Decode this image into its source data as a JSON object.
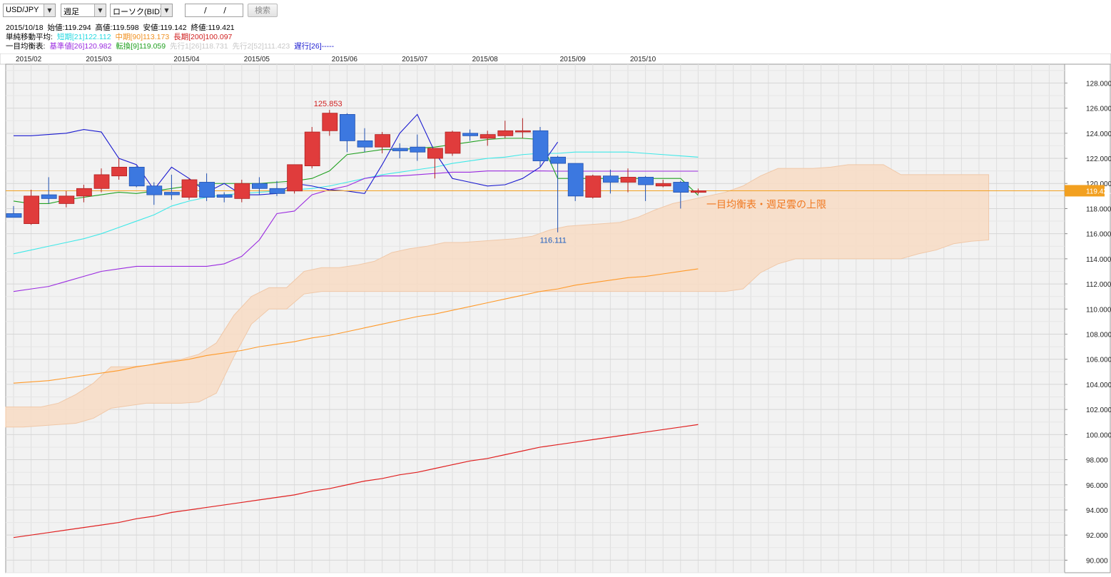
{
  "toolbar": {
    "symbol": "USD/JPY",
    "period": "週足",
    "chart_type": "ローソク(BID)",
    "date_value": "/ /",
    "search_label": "検索"
  },
  "ohlc_line": {
    "date": "2015/10/18",
    "open_label": "始値:119.294",
    "high_label": "高値:119.598",
    "low_label": "安値:119.142",
    "close_label": "終値:119.421"
  },
  "sma_line": {
    "label": "単純移動平均:",
    "short": "短期[21]122.112",
    "mid": "中期[90]113.173",
    "long": "長期[200]100.097"
  },
  "ichimoku_line": {
    "label": "一目均衡表:",
    "kijun": "基準値[26]120.982",
    "tenkan": "転換[9]119.059",
    "senko1": "先行1[26]118.731",
    "senko2": "先行2[52]111.423",
    "chikou": "遅行[26]-----"
  },
  "colors": {
    "up": "#e03c3c",
    "down": "#3c78e0",
    "sma_short": "#3ee8e8",
    "sma_mid": "#ff9a2a",
    "sma_long": "#e02020",
    "kijun": "#9a2ae0",
    "tenkan": "#20a020",
    "chikou": "#1a1ad0",
    "cloud": "#f8dcc4",
    "current": "#f2a020"
  },
  "chart_data": {
    "type": "candlestick",
    "x_labels": [
      "2015/02",
      "2015/03",
      "2015/04",
      "2015/05",
      "2015/06",
      "2015/07",
      "2015/08",
      "2015/09",
      "2015/10"
    ],
    "y_ticks": [
      "90.000",
      "92.000",
      "94.000",
      "96.000",
      "98.000",
      "100.000",
      "102.000",
      "104.000",
      "106.000",
      "108.000",
      "110.000",
      "112.000",
      "114.000",
      "116.000",
      "118.000",
      "120.000",
      "122.000",
      "124.000",
      "126.000",
      "128.000"
    ],
    "ylim": [
      89,
      129.5
    ],
    "current_price": "119.421",
    "high_annotation": "125.853",
    "low_annotation": "116.111",
    "cloud_annotation": "一目均衡表・週足雲の上限",
    "candles": [
      {
        "o": 117.6,
        "h": 118.2,
        "l": 117.3,
        "c": 117.3
      },
      {
        "o": 116.8,
        "h": 119.5,
        "l": 116.7,
        "c": 119.0
      },
      {
        "o": 119.1,
        "h": 120.5,
        "l": 118.4,
        "c": 118.8
      },
      {
        "o": 118.4,
        "h": 119.4,
        "l": 118.1,
        "c": 119.0
      },
      {
        "o": 119.0,
        "h": 119.9,
        "l": 118.5,
        "c": 119.6
      },
      {
        "o": 119.6,
        "h": 121.2,
        "l": 119.3,
        "c": 120.7
      },
      {
        "o": 120.6,
        "h": 122.0,
        "l": 120.3,
        "c": 121.3
      },
      {
        "o": 121.3,
        "h": 121.4,
        "l": 119.7,
        "c": 119.8
      },
      {
        "o": 119.8,
        "h": 120.1,
        "l": 118.3,
        "c": 119.1
      },
      {
        "o": 119.3,
        "h": 120.7,
        "l": 118.7,
        "c": 119.1
      },
      {
        "o": 118.9,
        "h": 120.4,
        "l": 118.7,
        "c": 120.3
      },
      {
        "o": 120.1,
        "h": 120.8,
        "l": 118.6,
        "c": 118.9
      },
      {
        "o": 119.1,
        "h": 119.3,
        "l": 118.5,
        "c": 118.9
      },
      {
        "o": 118.8,
        "h": 120.3,
        "l": 118.5,
        "c": 120.0
      },
      {
        "o": 120.0,
        "h": 120.5,
        "l": 119.1,
        "c": 119.6
      },
      {
        "o": 119.6,
        "h": 120.2,
        "l": 119.0,
        "c": 119.2
      },
      {
        "o": 119.4,
        "h": 121.5,
        "l": 119.2,
        "c": 121.5
      },
      {
        "o": 121.4,
        "h": 124.5,
        "l": 121.2,
        "c": 124.1
      },
      {
        "o": 124.2,
        "h": 125.853,
        "l": 123.8,
        "c": 125.6
      },
      {
        "o": 125.5,
        "h": 125.6,
        "l": 122.5,
        "c": 123.4
      },
      {
        "o": 123.4,
        "h": 124.4,
        "l": 122.5,
        "c": 122.9
      },
      {
        "o": 122.9,
        "h": 124.1,
        "l": 122.4,
        "c": 123.9
      },
      {
        "o": 122.8,
        "h": 123.2,
        "l": 122.0,
        "c": 122.6
      },
      {
        "o": 122.9,
        "h": 123.9,
        "l": 121.8,
        "c": 122.5
      },
      {
        "o": 122.0,
        "h": 122.8,
        "l": 120.4,
        "c": 122.8
      },
      {
        "o": 122.4,
        "h": 124.2,
        "l": 122.2,
        "c": 124.1
      },
      {
        "o": 124.0,
        "h": 124.3,
        "l": 123.4,
        "c": 123.8
      },
      {
        "o": 123.6,
        "h": 124.2,
        "l": 123.0,
        "c": 123.9
      },
      {
        "o": 123.8,
        "h": 125.0,
        "l": 123.6,
        "c": 124.2
      },
      {
        "o": 124.1,
        "h": 125.2,
        "l": 123.6,
        "c": 124.2
      },
      {
        "o": 124.2,
        "h": 124.5,
        "l": 121.3,
        "c": 121.8
      },
      {
        "o": 122.1,
        "h": 122.2,
        "l": 116.111,
        "c": 121.6
      },
      {
        "o": 121.6,
        "h": 121.6,
        "l": 118.6,
        "c": 119.0
      },
      {
        "o": 118.9,
        "h": 120.7,
        "l": 118.8,
        "c": 120.6
      },
      {
        "o": 120.6,
        "h": 121.1,
        "l": 119.2,
        "c": 120.1
      },
      {
        "o": 120.1,
        "h": 121.2,
        "l": 119.3,
        "c": 120.5
      },
      {
        "o": 120.5,
        "h": 120.6,
        "l": 118.6,
        "c": 119.9
      },
      {
        "o": 119.8,
        "h": 120.3,
        "l": 119.7,
        "c": 120.0
      },
      {
        "o": 120.1,
        "h": 120.2,
        "l": 118.0,
        "c": 119.3
      },
      {
        "o": 119.294,
        "h": 119.598,
        "l": 119.142,
        "c": 119.421
      }
    ],
    "sma_short": [
      114.4,
      114.7,
      115.0,
      115.3,
      115.6,
      116.0,
      116.5,
      117.0,
      117.5,
      118.2,
      118.6,
      118.9,
      119.1,
      119.2,
      119.3,
      119.4,
      119.5,
      119.6,
      119.8,
      120.1,
      120.4,
      120.7,
      120.9,
      121.1,
      121.3,
      121.6,
      121.8,
      122.0,
      122.1,
      122.3,
      122.4,
      122.4,
      122.5,
      122.5,
      122.5,
      122.5,
      122.4,
      122.3,
      122.2,
      122.1
    ],
    "sma_mid": [
      104.1,
      104.2,
      104.3,
      104.5,
      104.7,
      104.9,
      105.1,
      105.4,
      105.6,
      105.8,
      106.0,
      106.3,
      106.5,
      106.7,
      107.0,
      107.2,
      107.4,
      107.7,
      107.9,
      108.2,
      108.5,
      108.8,
      109.1,
      109.4,
      109.6,
      109.9,
      110.2,
      110.5,
      110.8,
      111.1,
      111.4,
      111.6,
      111.9,
      112.1,
      112.3,
      112.5,
      112.6,
      112.8,
      113.0,
      113.2
    ],
    "sma_long": [
      91.8,
      92.0,
      92.2,
      92.4,
      92.6,
      92.8,
      93.0,
      93.3,
      93.5,
      93.8,
      94.0,
      94.2,
      94.4,
      94.6,
      94.8,
      95.0,
      95.2,
      95.5,
      95.7,
      96.0,
      96.3,
      96.5,
      96.8,
      97.0,
      97.3,
      97.6,
      97.9,
      98.1,
      98.4,
      98.7,
      99.0,
      99.2,
      99.4,
      99.6,
      99.8,
      100.0,
      100.2,
      100.4,
      100.6,
      100.8
    ],
    "kijun": [
      111.4,
      111.6,
      111.8,
      112.2,
      112.6,
      113.0,
      113.2,
      113.4,
      113.4,
      113.4,
      113.4,
      113.4,
      113.6,
      114.2,
      115.5,
      117.6,
      117.8,
      119.1,
      119.5,
      119.8,
      120.4,
      120.6,
      120.6,
      120.7,
      120.8,
      120.9,
      120.9,
      121.0,
      121.0,
      121.0,
      121.0,
      120.98,
      120.98,
      120.98,
      120.98,
      120.98,
      120.98,
      120.98,
      120.98,
      120.98
    ],
    "tenkan": [
      118.6,
      118.4,
      118.4,
      118.7,
      118.9,
      119.1,
      119.3,
      119.2,
      119.4,
      119.6,
      119.8,
      120.0,
      120.0,
      120.0,
      120.0,
      120.1,
      120.2,
      120.4,
      121.0,
      122.3,
      122.5,
      122.7,
      122.7,
      122.8,
      122.9,
      123.1,
      123.3,
      123.5,
      123.6,
      123.6,
      123.5,
      120.4,
      120.4,
      120.4,
      120.4,
      120.4,
      120.4,
      120.4,
      120.4,
      119.06
    ],
    "chikou": [
      123.8,
      123.8,
      123.9,
      124.0,
      124.3,
      124.1,
      122.0,
      121.5,
      119.5,
      121.3,
      120.4,
      119.3,
      120.0,
      119.1,
      119.1,
      119.2,
      120.0,
      119.8,
      119.5,
      119.4,
      119.2,
      121.5,
      124.0,
      125.5,
      122.5,
      120.4,
      120.1,
      119.8,
      119.9,
      120.4,
      121.3,
      123.3
    ],
    "cloud_top": [
      102.2,
      102.2,
      102.2,
      102.5,
      103.2,
      104.1,
      105.4,
      105.4,
      105.5,
      105.8,
      106.0,
      106.4,
      107.3,
      109.5,
      111.0,
      111.7,
      111.7,
      113.0,
      113.3,
      113.3,
      113.5,
      113.8,
      114.5,
      114.8,
      115.0,
      115.3,
      115.3,
      115.4,
      115.5,
      115.6,
      115.8,
      116.3,
      116.6,
      116.7,
      116.8,
      116.9,
      117.3,
      117.9,
      118.4,
      118.7,
      119.0,
      119.3,
      119.8,
      120.6,
      121.2,
      121.2,
      121.2,
      121.3,
      121.5,
      121.5,
      121.5,
      120.7,
      120.7,
      120.7,
      120.7,
      120.7,
      120.7
    ],
    "cloud_bottom": [
      100.6,
      100.6,
      100.7,
      100.8,
      100.9,
      101.3,
      102.1,
      102.3,
      102.5,
      102.5,
      102.5,
      102.6,
      103.3,
      106.2,
      108.8,
      110.0,
      110.0,
      111.2,
      111.4,
      111.4,
      111.4,
      111.4,
      111.4,
      111.4,
      111.4,
      111.4,
      111.4,
      111.4,
      111.4,
      111.4,
      111.4,
      111.4,
      111.4,
      111.4,
      111.4,
      111.4,
      111.4,
      111.4,
      111.4,
      111.4,
      111.4,
      111.4,
      111.6,
      112.9,
      113.6,
      114.0,
      114.0,
      114.0,
      114.0,
      114.0,
      114.0,
      114.0,
      114.4,
      114.7,
      115.2,
      115.4,
      115.5
    ]
  }
}
